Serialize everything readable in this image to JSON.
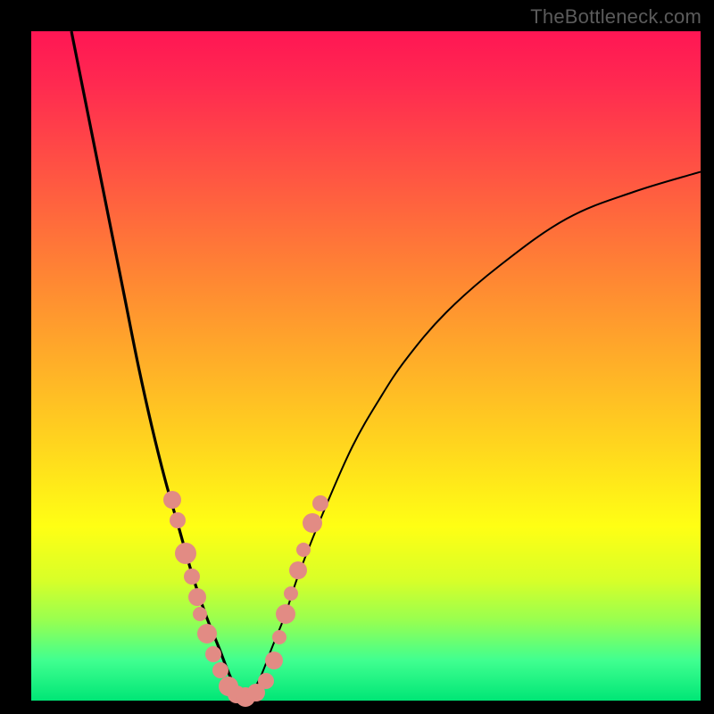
{
  "watermark": "TheBottleneck.com",
  "colors": {
    "frame": "#000000",
    "curve": "#000000",
    "dot": "#e28b84",
    "gradient_top": "#ff1654",
    "gradient_bottom": "#00e676"
  },
  "chart_data": {
    "type": "line",
    "title": "",
    "xlabel": "",
    "ylabel": "",
    "xlim": [
      0,
      100
    ],
    "ylim": [
      0,
      100
    ],
    "grid": false,
    "legend": false,
    "series": [
      {
        "name": "bottleneck-curve-left",
        "x": [
          6,
          8,
          10,
          12,
          14,
          16,
          18,
          20,
          22,
          24,
          26,
          28,
          30,
          32
        ],
        "values": [
          100,
          90,
          80,
          70,
          60,
          50,
          41,
          33,
          26,
          19,
          13,
          8,
          3,
          0
        ]
      },
      {
        "name": "bottleneck-curve-right",
        "x": [
          32,
          34,
          36,
          38,
          40,
          44,
          48,
          52,
          56,
          62,
          70,
          80,
          90,
          100
        ],
        "values": [
          0,
          3,
          8,
          13,
          19,
          29,
          38,
          45,
          51,
          58,
          65,
          72,
          76,
          79
        ]
      }
    ],
    "annotations": {
      "dots": [
        {
          "x": 21.0,
          "y": 30.0,
          "r": 10
        },
        {
          "x": 21.8,
          "y": 27.0,
          "r": 9
        },
        {
          "x": 23.0,
          "y": 22.0,
          "r": 12
        },
        {
          "x": 24.0,
          "y": 18.5,
          "r": 9
        },
        {
          "x": 24.8,
          "y": 15.5,
          "r": 10
        },
        {
          "x": 25.2,
          "y": 13.0,
          "r": 8
        },
        {
          "x": 26.2,
          "y": 10.0,
          "r": 11
        },
        {
          "x": 27.2,
          "y": 7.0,
          "r": 9
        },
        {
          "x": 28.2,
          "y": 4.5,
          "r": 9
        },
        {
          "x": 29.4,
          "y": 2.2,
          "r": 11
        },
        {
          "x": 30.6,
          "y": 1.0,
          "r": 10
        },
        {
          "x": 32.0,
          "y": 0.6,
          "r": 11
        },
        {
          "x": 33.6,
          "y": 1.2,
          "r": 10
        },
        {
          "x": 35.0,
          "y": 3.0,
          "r": 9
        },
        {
          "x": 36.2,
          "y": 6.0,
          "r": 10
        },
        {
          "x": 37.0,
          "y": 9.5,
          "r": 8
        },
        {
          "x": 38.0,
          "y": 13.0,
          "r": 11
        },
        {
          "x": 38.8,
          "y": 16.0,
          "r": 8
        },
        {
          "x": 39.8,
          "y": 19.5,
          "r": 10
        },
        {
          "x": 40.6,
          "y": 22.5,
          "r": 8
        },
        {
          "x": 42.0,
          "y": 26.5,
          "r": 11
        },
        {
          "x": 43.2,
          "y": 29.5,
          "r": 9
        }
      ]
    }
  }
}
